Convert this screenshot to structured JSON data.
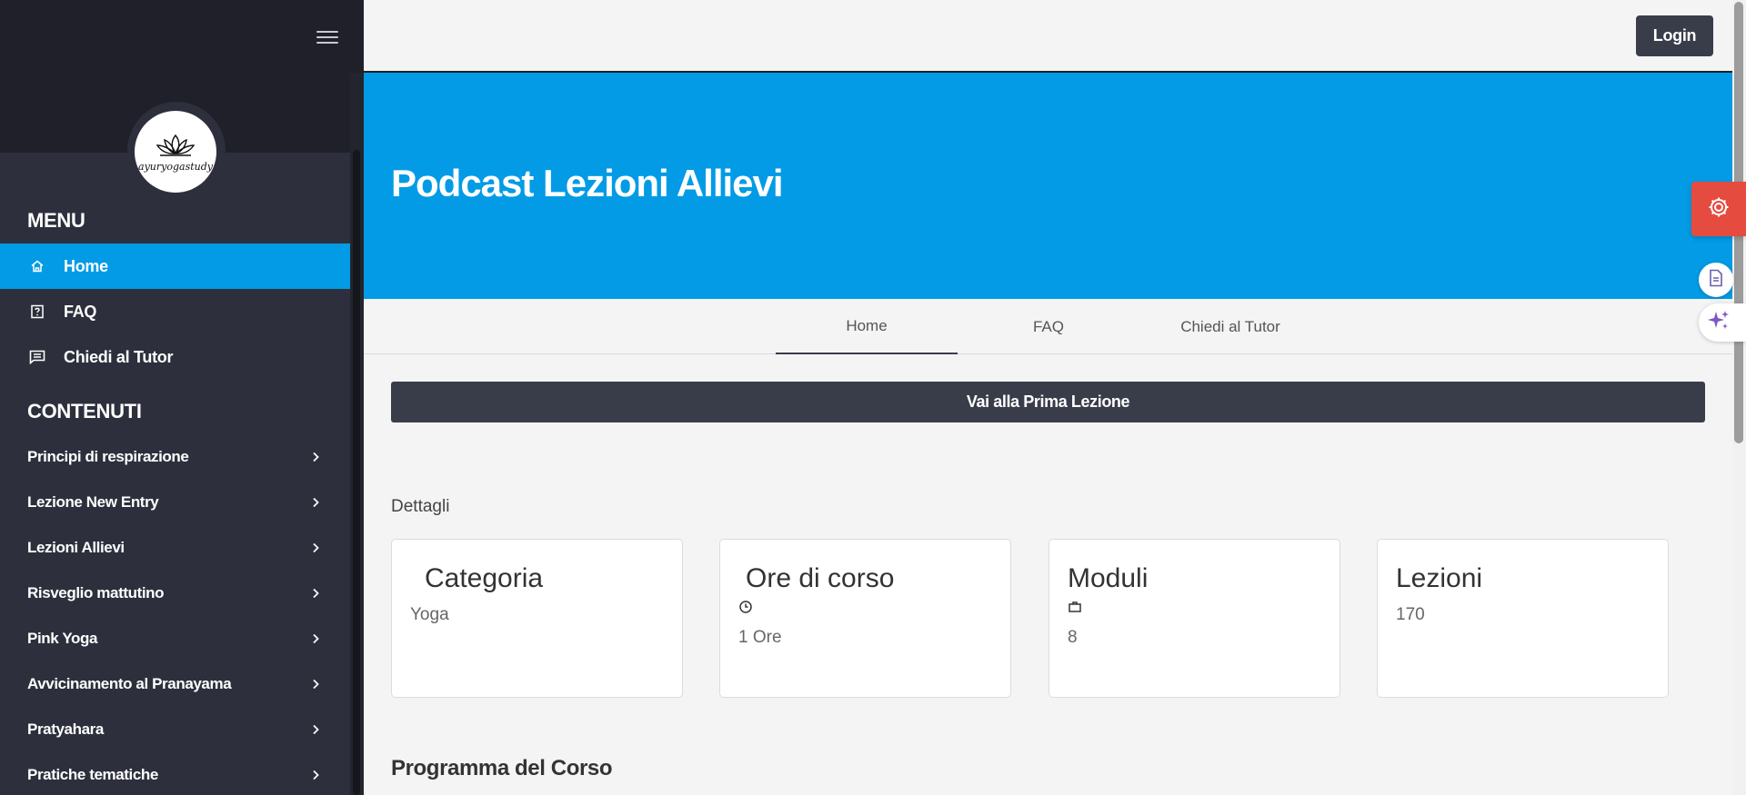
{
  "sidebar": {
    "logo_text": "ayuryogastudy",
    "menu_title": "MENU",
    "menu_items": [
      {
        "label": "Home",
        "icon": "home-icon",
        "active": true
      },
      {
        "label": "FAQ",
        "icon": "faq-icon",
        "active": false
      },
      {
        "label": "Chiedi al Tutor",
        "icon": "chat-icon",
        "active": false
      }
    ],
    "contents_title": "CONTENUTI",
    "contents": [
      {
        "label": "Principi di respirazione"
      },
      {
        "label": "Lezione New Entry"
      },
      {
        "label": "Lezioni Allievi"
      },
      {
        "label": "Risveglio mattutino"
      },
      {
        "label": "Pink Yoga"
      },
      {
        "label": "Avvicinamento al Pranayama"
      },
      {
        "label": "Pratyahara"
      },
      {
        "label": "Pratiche tematiche"
      }
    ]
  },
  "header": {
    "login_label": "Login"
  },
  "hero": {
    "title": "Podcast Lezioni Allievi",
    "bg_color": "#039be5"
  },
  "tabs": [
    {
      "label": "Home",
      "active": true
    },
    {
      "label": "FAQ",
      "active": false
    },
    {
      "label": "Chiedi al Tutor",
      "active": false
    }
  ],
  "cta_label": "Vai alla Prima Lezione",
  "details": {
    "label": "Dettagli",
    "cards": [
      {
        "title": "Categoria",
        "icon": "",
        "value": "Yoga"
      },
      {
        "title": "Ore di corso",
        "icon": "clock-icon",
        "value": "1 Ore"
      },
      {
        "title": "Moduli",
        "icon": "briefcase-icon",
        "value": "8"
      },
      {
        "title": "Lezioni",
        "icon": "",
        "value": "170"
      }
    ]
  },
  "program_title": "Programma del Corso",
  "colors": {
    "sidebar_bg": "#2d303c",
    "sidebar_top": "#1f2029",
    "accent": "#039be5",
    "dark_button": "#393d4a",
    "widget_red": "#e54b3f"
  }
}
